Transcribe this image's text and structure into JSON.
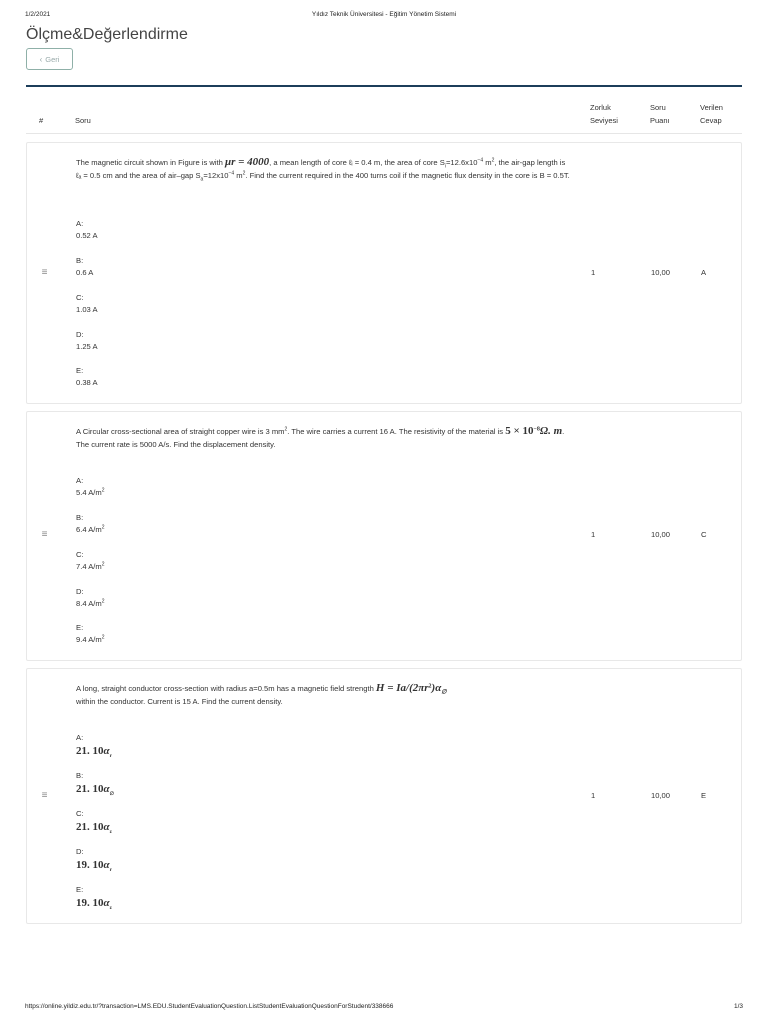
{
  "print": {
    "date": "1/2/2021",
    "title": "Yıldız Teknik Üniversitesi - Eğitim Yönetim Sistemi",
    "url": "https://online.yildiz.edu.tr/?transaction=LMS.EDU.StudentEvaluationQuestion.ListStudentEvaluationQuestionForStudent/338666",
    "page": "1/3"
  },
  "page_title": "Ölçme&Değerlendirme",
  "back_label": "Geri",
  "icons": {
    "back": "chevron-left-icon",
    "drag": "hamburger-icon"
  },
  "columns": {
    "num": "#",
    "question": "Soru",
    "difficulty_1": "Zorluk",
    "difficulty_2": "Seviyesi",
    "score_1": "Soru",
    "score_2": "Puanı",
    "answer_1": "Verilen",
    "answer_2": "Cevap"
  },
  "questions": [
    {
      "text": {
        "p1": "The magnetic circuit shown in Figure is with ",
        "m1": "μr = 4000",
        "p2": ", a mean length of core ℓᵢ = 0.4 m, the area of core S",
        "p3": "=12.6x10",
        "p4": " m",
        "p5": ", the air-gap length is ℓₐ = 0.5 cm and the area of air–gap S",
        "p6": "=12x10",
        "p7": " m",
        "p8": ". Find the current required in the 400 turns coil if the magnetic flux density in the core is B = 0.5T.",
        "sub_i": "i",
        "sub_a": "a",
        "exp_neg4": "−4",
        "exp_2": "2"
      },
      "options": [
        {
          "letter": "A:",
          "value": "0.52 A"
        },
        {
          "letter": "B:",
          "value": "0.6 A"
        },
        {
          "letter": "C:",
          "value": "1.03 A"
        },
        {
          "letter": "D:",
          "value": "1.25 A"
        },
        {
          "letter": "E:",
          "value": "0.38 A"
        }
      ],
      "difficulty": "1",
      "score": "10,00",
      "answer": "A"
    },
    {
      "text": {
        "p1": "A Circular cross-sectional area of straight copper wire is 3 mm",
        "p2": ". The wire carries a current 16 A. The resistivity of the material is ",
        "m1": "5 × 10",
        "m1_exp": "−8",
        "m2": "Ω. m",
        "p3": ". The current rate is 5000 A/s. Find the displacement density.",
        "exp_2": "2"
      },
      "options": [
        {
          "letter": "A:",
          "value": "5.4 A/m",
          "exp": "2"
        },
        {
          "letter": "B:",
          "value": "6.4 A/m",
          "exp": "2"
        },
        {
          "letter": "C:",
          "value": "7.4 A/m",
          "exp": "2"
        },
        {
          "letter": "D:",
          "value": "8.4 A/m",
          "exp": "2"
        },
        {
          "letter": "E:",
          "value": "9.4 A/m",
          "exp": "2"
        }
      ],
      "difficulty": "1",
      "score": "10,00",
      "answer": "C"
    },
    {
      "text": {
        "p1": "A long, straight conductor cross-section with radius a=0.5m has a magnetic field strength ",
        "m1": "H = Ia/(2πr",
        "m1_exp": "2",
        "m1_end": ")α",
        "m1_sub": "∅",
        "p2": " within the conductor. Current is 15 A. Find the current density."
      },
      "options": [
        {
          "letter": "A:",
          "num": "21. 10",
          "alpha": "α",
          "sub": "r"
        },
        {
          "letter": "B:",
          "num": "21. 10",
          "alpha": "α",
          "sub": "∅"
        },
        {
          "letter": "C:",
          "num": "21. 10",
          "alpha": "α",
          "sub": "z"
        },
        {
          "letter": "D:",
          "num": "19. 10",
          "alpha": "α",
          "sub": "r"
        },
        {
          "letter": "E:",
          "num": "19. 10",
          "alpha": "α",
          "sub": "z"
        }
      ],
      "difficulty": "1",
      "score": "10,00",
      "answer": "E"
    }
  ]
}
